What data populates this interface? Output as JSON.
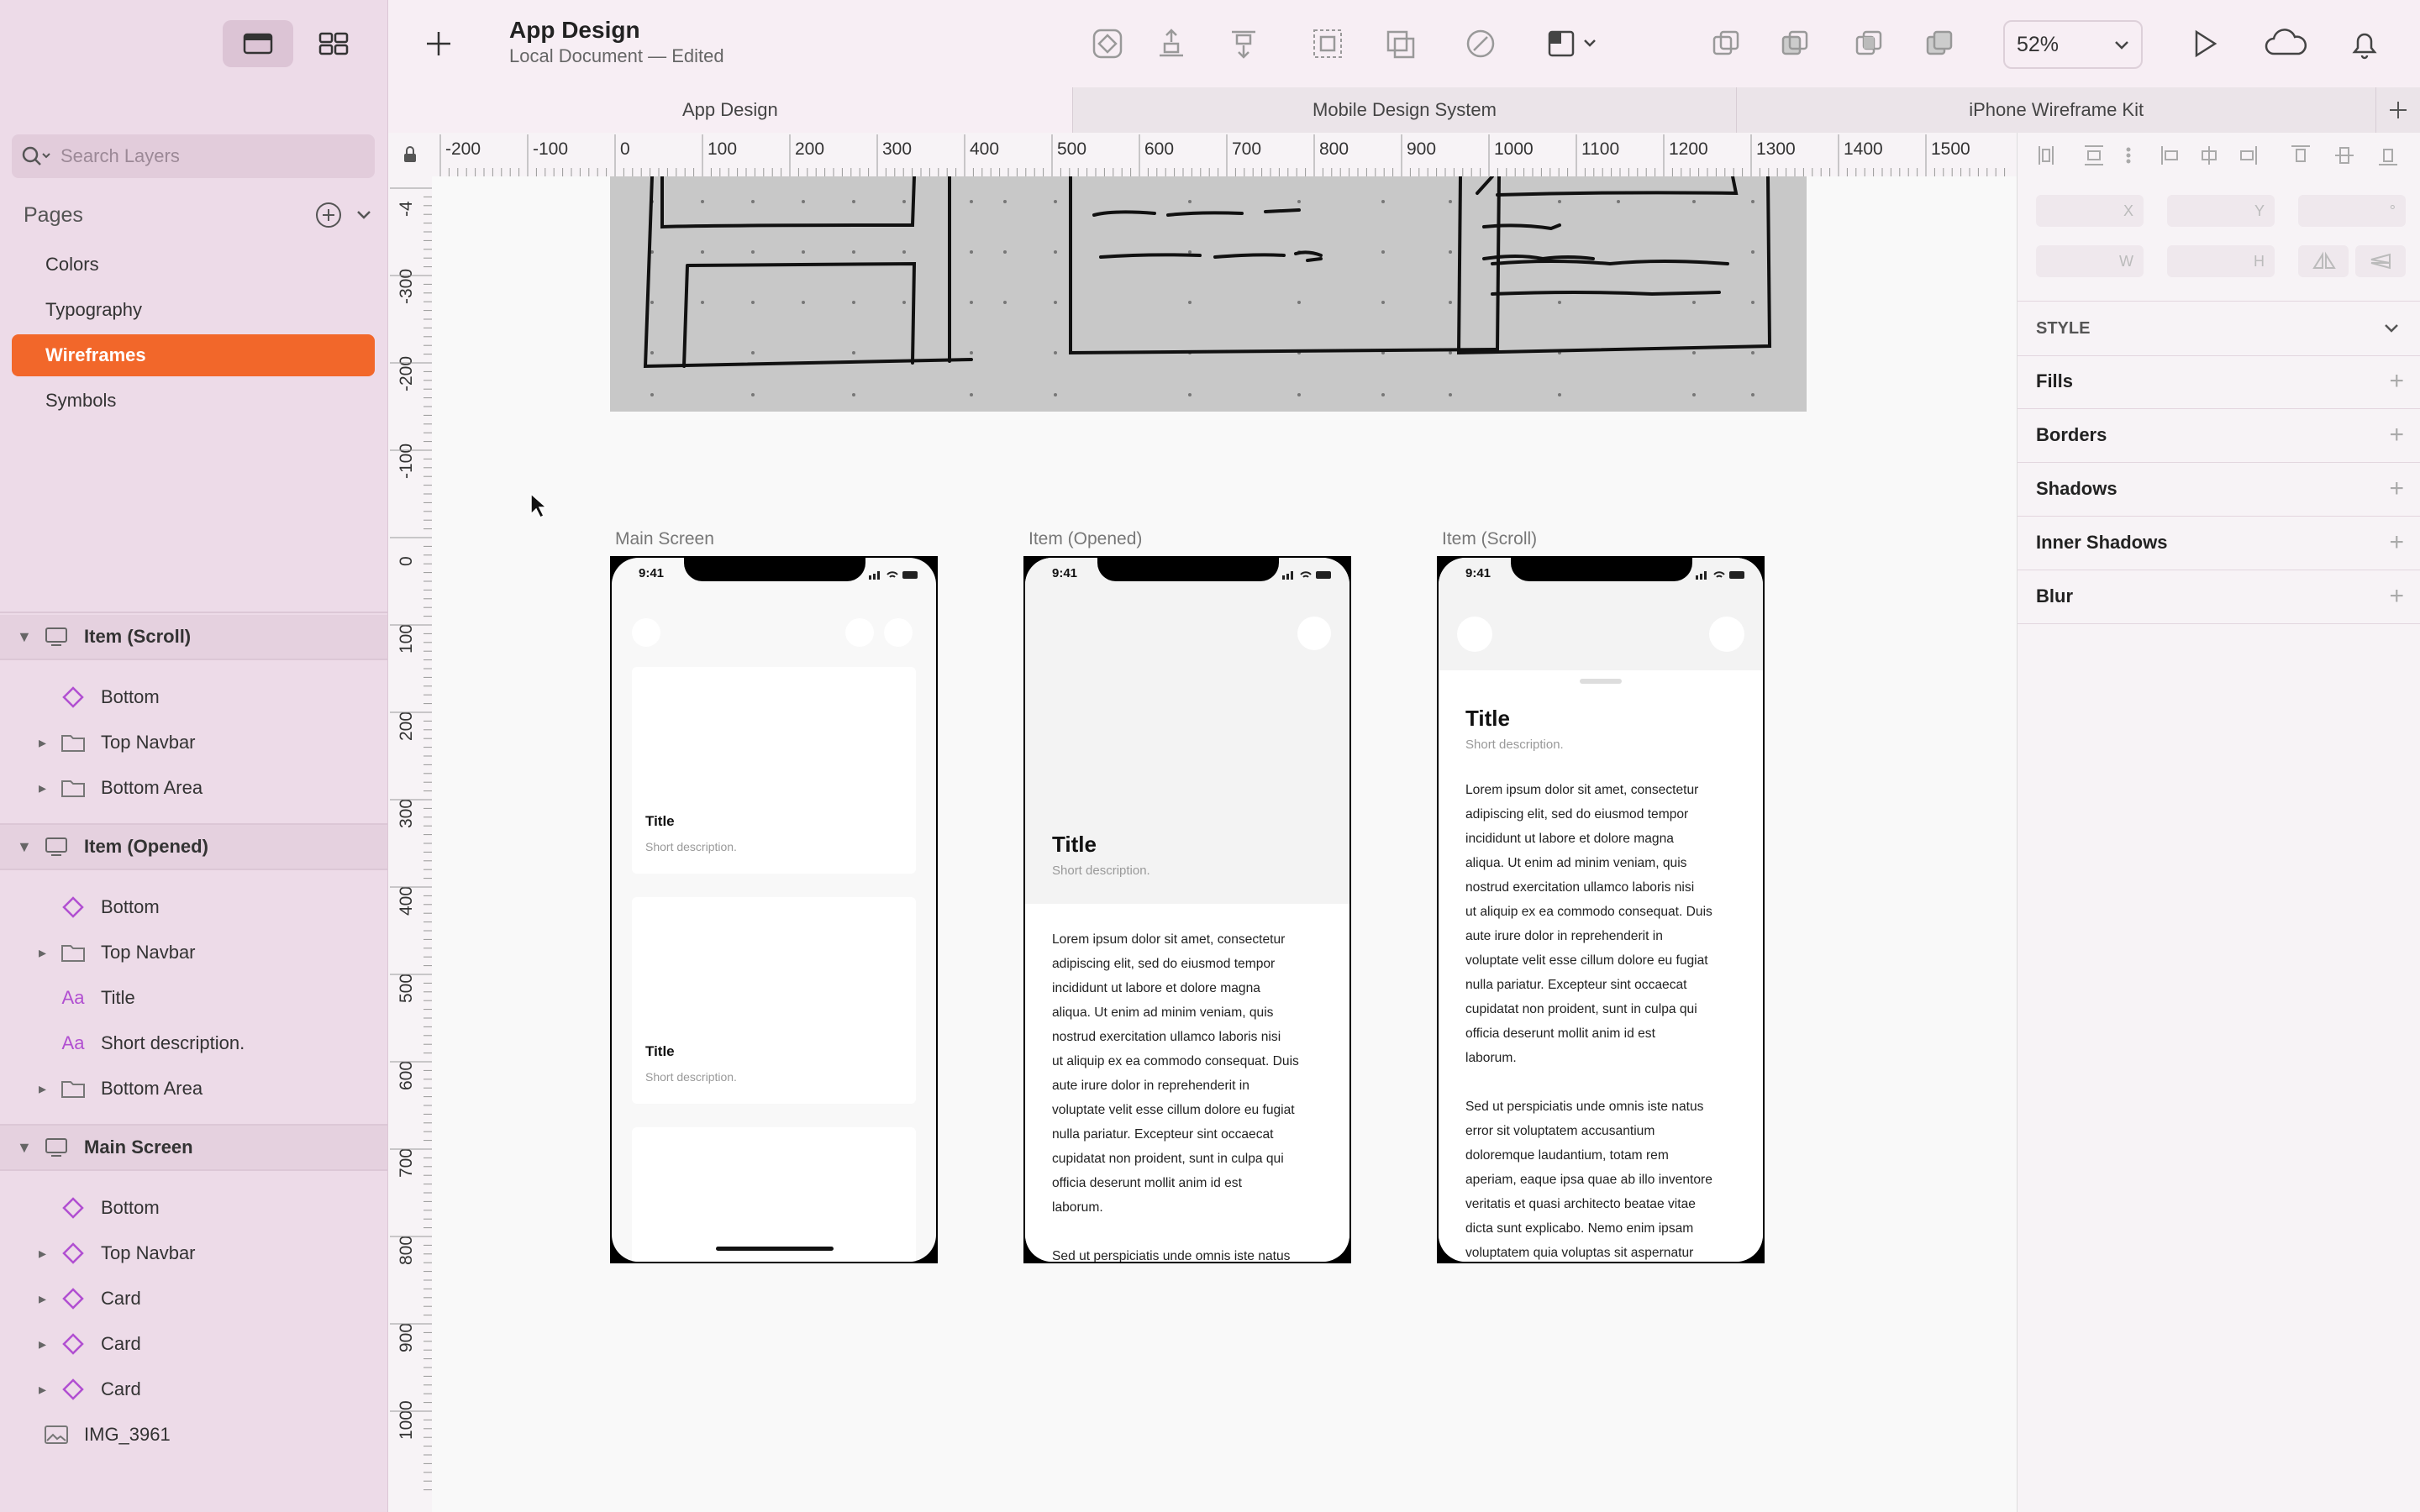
{
  "document": {
    "title": "App Design",
    "subtitle": "Local Document — Edited"
  },
  "toolbar": {
    "zoom": "52%"
  },
  "tabs": [
    "App Design",
    "Mobile Design System",
    "iPhone Wireframe Kit"
  ],
  "sidebar": {
    "search_placeholder": "Search Layers",
    "pages_label": "Pages",
    "pages": [
      "Colors",
      "Typography",
      "Wireframes",
      "Symbols"
    ],
    "active_page": "Wireframes",
    "layers": {
      "item_scroll": {
        "name": "Item (Scroll)",
        "children": [
          "Bottom",
          "Top Navbar",
          "Bottom Area"
        ]
      },
      "item_opened": {
        "name": "Item (Opened)",
        "children": [
          "Bottom",
          "Top Navbar",
          "Title",
          "Short description.",
          "Bottom Area"
        ]
      },
      "main_screen": {
        "name": "Main Screen",
        "children": [
          "Bottom",
          "Top Navbar",
          "Card",
          "Card",
          "Card"
        ]
      },
      "image": "IMG_3961"
    }
  },
  "rulers": {
    "horizontal": [
      "-200",
      "-100",
      "0",
      "100",
      "200",
      "300",
      "400",
      "500",
      "600",
      "700",
      "800",
      "900",
      "1000",
      "1100",
      "1200",
      "1300",
      "1400",
      "1500"
    ],
    "vertical": [
      "-4",
      "-300",
      "-200",
      "-100",
      "0",
      "100",
      "200",
      "300",
      "400",
      "500",
      "600",
      "700",
      "800",
      "900",
      "1000"
    ]
  },
  "artboards": {
    "main": {
      "label": "Main Screen",
      "time": "9:41",
      "cards": [
        {
          "title": "Title",
          "desc": "Short description."
        },
        {
          "title": "Title",
          "desc": "Short description."
        }
      ]
    },
    "opened": {
      "label": "Item (Opened)",
      "time": "9:41",
      "title": "Title",
      "desc": "Short description.",
      "body": [
        "Lorem ipsum dolor sit amet, consectetur",
        "adipiscing elit, sed do eiusmod tempor",
        "incididunt ut labore et dolore magna",
        "aliqua. Ut enim ad minim veniam, quis",
        "nostrud exercitation ullamco laboris nisi",
        "ut aliquip ex ea commodo consequat. Duis",
        "aute irure dolor in reprehenderit in",
        "voluptate velit esse cillum dolore eu fugiat",
        "nulla pariatur. Excepteur sint occaecat",
        "cupidatat non proident, sunt in culpa qui",
        "officia deserunt mollit anim id est",
        "laborum.",
        "",
        "Sed ut perspiciatis unde omnis iste natus"
      ]
    },
    "scroll": {
      "label": "Item (Scroll)",
      "time": "9:41",
      "title": "Title",
      "desc": "Short description.",
      "body": [
        "Lorem ipsum dolor sit amet, consectetur",
        "adipiscing elit, sed do eiusmod tempor",
        "incididunt ut labore et dolore magna",
        "aliqua. Ut enim ad minim veniam, quis",
        "nostrud exercitation ullamco laboris nisi",
        "ut aliquip ex ea commodo consequat. Duis",
        "aute irure dolor in reprehenderit in",
        "voluptate velit esse cillum dolore eu fugiat",
        "nulla pariatur. Excepteur sint occaecat",
        "cupidatat non proident, sunt in culpa qui",
        "officia deserunt mollit anim id est",
        "laborum.",
        "",
        "Sed ut perspiciatis unde omnis iste natus",
        "error sit voluptatem accusantium",
        "doloremque laudantium, totam rem",
        "aperiam, eaque ipsa quae ab illo inventore",
        "veritatis et quasi architecto beatae vitae",
        "dicta sunt explicabo. Nemo enim ipsam",
        "voluptatem quia voluptas sit aspernatur"
      ]
    }
  },
  "inspector": {
    "fields": [
      "X",
      "Y",
      "°",
      "W",
      "H"
    ],
    "style_label": "STYLE",
    "sections": [
      "Fills",
      "Borders",
      "Shadows",
      "Inner Shadows",
      "Blur"
    ]
  },
  "colors": {
    "accent": "#f2672a",
    "sidebar_bg": "#eddbe8"
  }
}
